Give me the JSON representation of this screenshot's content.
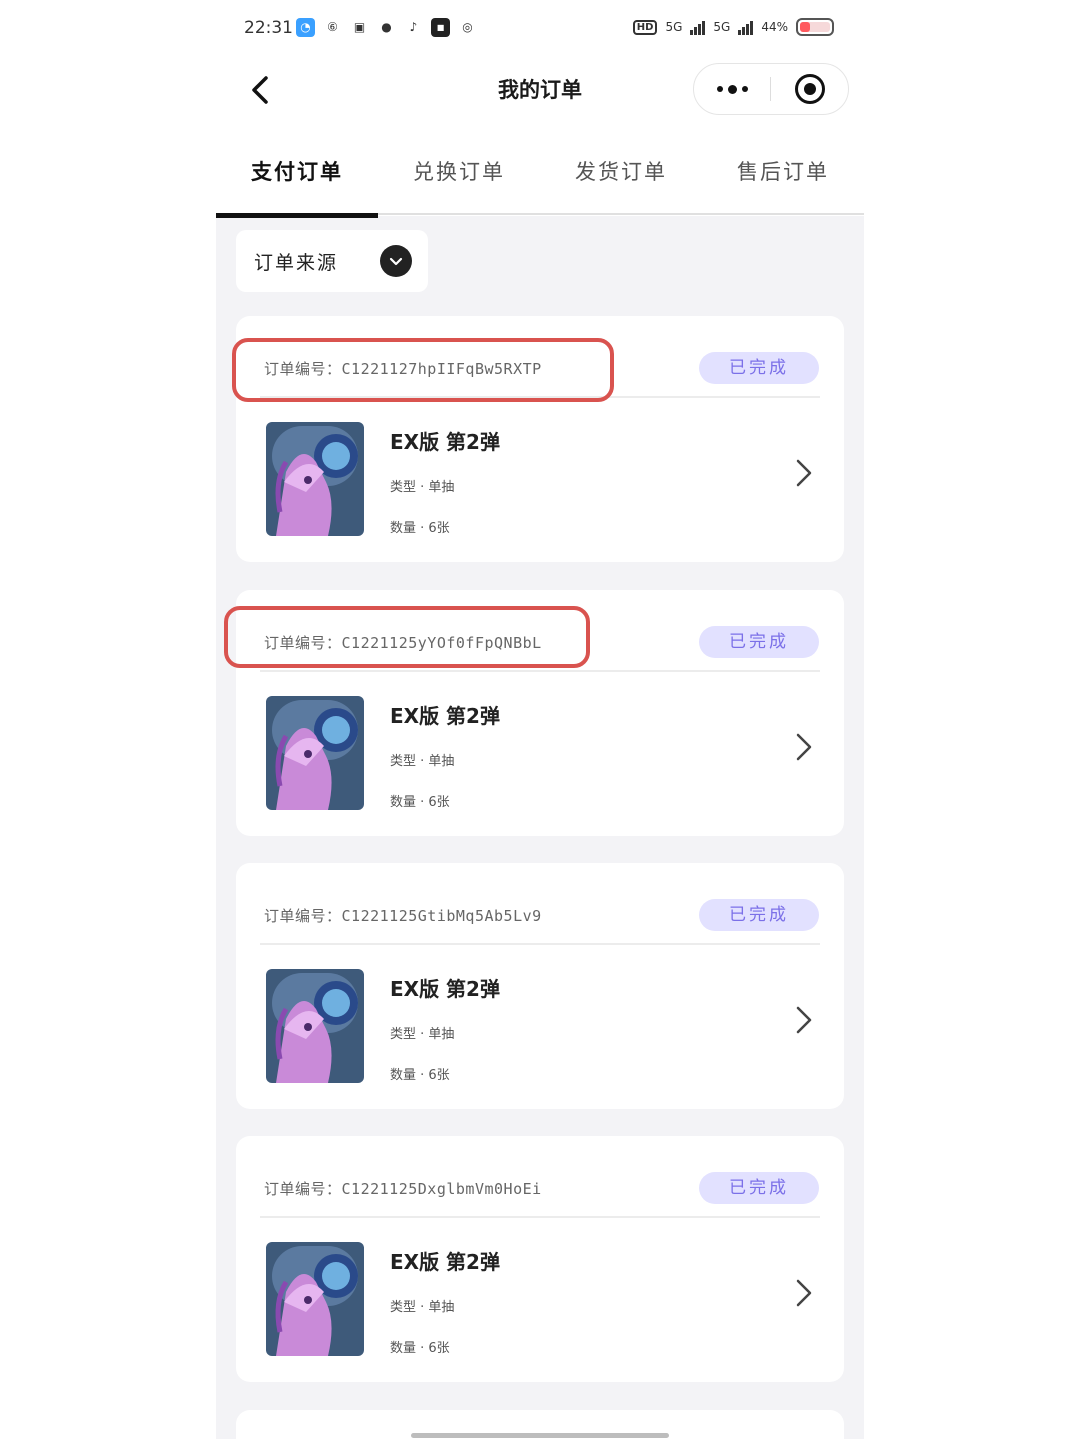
{
  "status_bar": {
    "time": "22:31",
    "battery": "44%",
    "network_labels": [
      "HD",
      "5G",
      "5G"
    ]
  },
  "nav": {
    "title": "我的订单"
  },
  "tabs": [
    {
      "label": "支付订单",
      "active": true
    },
    {
      "label": "兑换订单",
      "active": false
    },
    {
      "label": "发货订单",
      "active": false
    },
    {
      "label": "售后订单",
      "active": false
    }
  ],
  "filter": {
    "label": "订单来源"
  },
  "orders": [
    {
      "order_label": "订单编号：",
      "order_no": "C1221127hpIIFqBw5RXTP",
      "status": "已完成",
      "product_title": "EX版  第2弹",
      "type_line": "类型 · 单抽",
      "qty_line": "数量 · 6张"
    },
    {
      "order_label": "订单编号：",
      "order_no": "C1221125yYOf0fFpQNBbL",
      "status": "已完成",
      "product_title": "EX版  第2弹",
      "type_line": "类型 · 单抽",
      "qty_line": "数量 · 6张"
    },
    {
      "order_label": "订单编号：",
      "order_no": "C1221125GtibMq5Ab5Lv9",
      "status": "已完成",
      "product_title": "EX版  第2弹",
      "type_line": "类型 · 单抽",
      "qty_line": "数量 · 6张"
    },
    {
      "order_label": "订单编号：",
      "order_no": "C1221125DxglbmVm0HoEi",
      "status": "已完成",
      "product_title": "EX版  第2弹",
      "type_line": "类型 · 单抽",
      "qty_line": "数量 · 6张"
    }
  ],
  "colors": {
    "accent_badge_bg": "#e2e1ff",
    "accent_badge_text": "#7b70e8",
    "highlight": "#d9534f",
    "page_bg": "#f3f3f6"
  }
}
